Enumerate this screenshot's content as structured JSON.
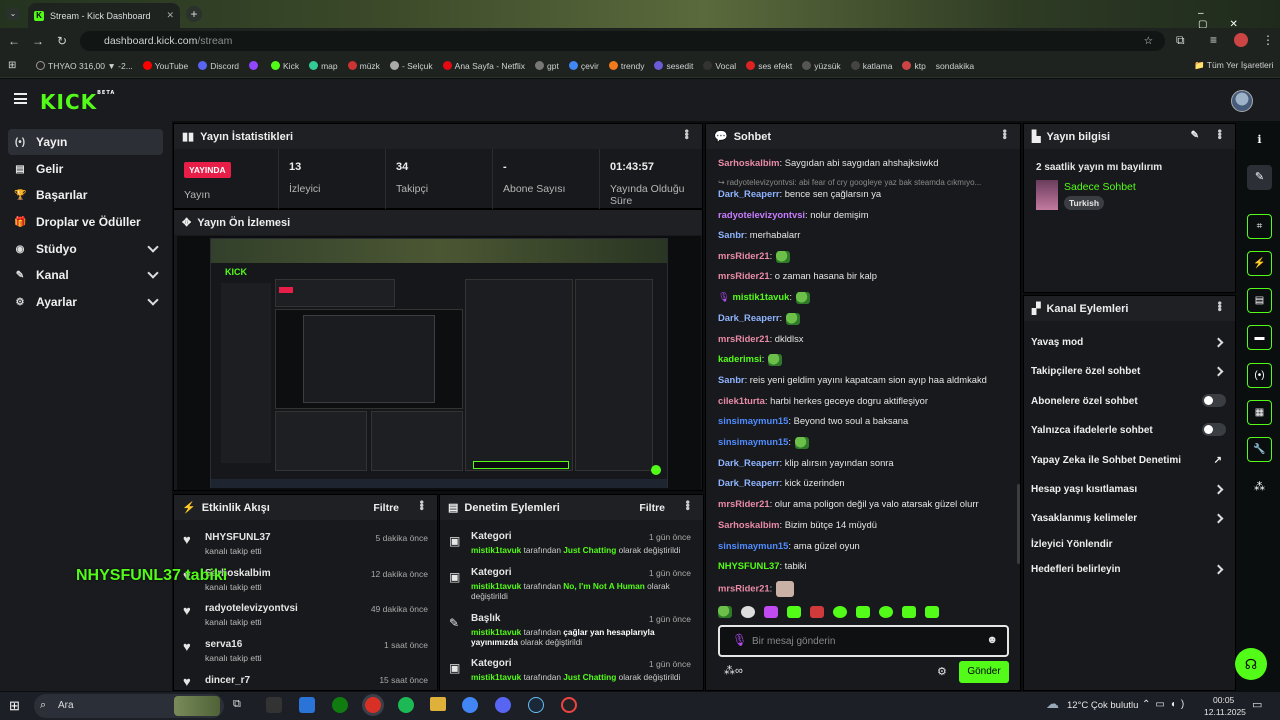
{
  "browser": {
    "tab_title": "Stream - Kick Dashboard",
    "url_host": "dashboard.kick.com",
    "url_path": "/stream",
    "bookmarks": [
      "THYAO 316,00 ▼ -2...",
      "YouTube",
      "Discord",
      "",
      "Kick",
      "map",
      "müzk",
      "- Selçuk",
      "Ana Sayfa - Netflix",
      "gpt",
      "çevir",
      "trendy",
      "sesedit",
      "Vocal",
      "ses efekt",
      "yüzsük",
      "katlama",
      "ktp",
      "sondakika"
    ],
    "all_bookmarks": "Tüm Yer İşaretleri"
  },
  "sidebar": {
    "items": [
      {
        "label": "Yayın",
        "icon": "(•)"
      },
      {
        "label": "Gelir",
        "icon": "▤"
      },
      {
        "label": "Başarılar",
        "icon": "🏆"
      },
      {
        "label": "Droplar ve Ödüller",
        "icon": "🎁"
      },
      {
        "label": "Stüdyo",
        "icon": "◉"
      },
      {
        "label": "Kanal",
        "icon": "✎"
      },
      {
        "label": "Ayarlar",
        "icon": "⚙"
      }
    ]
  },
  "stats": {
    "title": "Yayın İstatistikleri",
    "live_badge": "YAYINDA",
    "live_label": "Yayın",
    "viewers_val": "13",
    "viewers_lbl": "İzleyici",
    "followers_val": "34",
    "followers_lbl": "Takipçi",
    "subs_val": "-",
    "subs_lbl": "Abone Sayısı",
    "uptime_val": "01:43:57",
    "uptime_lbl": "Yayında Olduğu Süre"
  },
  "preview": {
    "title": "Yayın Ön İzlemesi"
  },
  "activity": {
    "title": "Etkinlik Akışı",
    "filter": "Filtre",
    "items": [
      {
        "name": "NHYSFUNL37",
        "desc": "kanalı takip etti",
        "time": "5 dakika önce"
      },
      {
        "name": "Sarhoskalbim",
        "desc": "kanalı takip etti",
        "time": "12 dakika önce"
      },
      {
        "name": "radyotelevizyontvsi",
        "desc": "kanalı takip etti",
        "time": "49 dakika önce"
      },
      {
        "name": "serva16",
        "desc": "kanalı takip etti",
        "time": "1 saat önce"
      },
      {
        "name": "dincer_r7",
        "desc": "",
        "time": "15 saat önce"
      }
    ],
    "overlay": "NHYSFUNL37 tabiki"
  },
  "moderation": {
    "title": "Denetim Eylemleri",
    "filter": "Filtre",
    "items": [
      {
        "kind": "Kategori",
        "time": "1 gün önce",
        "user": "mistik1tavuk",
        "mid": " tarafından ",
        "value": "Just Chatting",
        "tail": " olarak değiştirildi"
      },
      {
        "kind": "Kategori",
        "time": "1 gün önce",
        "user": "mistik1tavuk",
        "mid": " tarafından ",
        "value": "No, I'm Not A Human",
        "tail": " olarak değiştirildi"
      },
      {
        "kind": "Başlık",
        "time": "1 gün önce",
        "user": "mistik1tavuk",
        "mid": " tarafından ",
        "value": "çağlar yan hesaplarıyla yayınımızda",
        "tail": " olarak değiştirildi"
      },
      {
        "kind": "Kategori",
        "time": "1 gün önce",
        "user": "mistik1tavuk",
        "mid": " tarafından ",
        "value": "Just Chatting",
        "tail": " olarak değiştirildi"
      }
    ]
  },
  "chat": {
    "title": "Sohbet",
    "messages": [
      {
        "user": "Sarhoskalbim",
        "color": "#e98ba7",
        "text": ": Saygıdan abi saygıdan ahshajksiwkd"
      },
      {
        "user": "",
        "color": "#8a8a8a",
        "text": "↪ radyotelevizyontvsi: abi fear of cry googleye yaz bak steamda cıkmıyo..."
      },
      {
        "user": "Dark_Reaperr",
        "color": "#8fb4ff",
        "text": ": bence sen çağlarsın ya"
      },
      {
        "user": "radyotelevizyontvsi",
        "color": "#c77dff",
        "text": ": nolur demişim"
      },
      {
        "user": "Sanbr",
        "color": "#8fb4ff",
        "text": ": merhabalarr"
      },
      {
        "user": "mrsRider21",
        "color": "#e98ba7",
        "text": ":"
      },
      {
        "user": "mrsRider21",
        "color": "#e98ba7",
        "text": ": o zaman hasana bir kalp"
      },
      {
        "user": "mistik1tavuk",
        "color": "#53fc18",
        "text": ":"
      },
      {
        "user": "Dark_Reaperr",
        "color": "#8fb4ff",
        "text": ":"
      },
      {
        "user": "mrsRider21",
        "color": "#e98ba7",
        "text": ": dkldlsx"
      },
      {
        "user": "kaderimsi",
        "color": "#53fc18",
        "text": ":"
      },
      {
        "user": "Sanbr",
        "color": "#8fb4ff",
        "text": ": reis yeni geldim yayını kapatcam sion ayıp haa aldmkakd"
      },
      {
        "user": "cilek1turta",
        "color": "#e98ba7",
        "text": ": harbi herkes geceye dogru aktifleşiyor"
      },
      {
        "user": "sinsimaymun15",
        "color": "#4f8cff",
        "text": ": Beyond two soul a baksana"
      },
      {
        "user": "sinsimaymun15",
        "color": "#4f8cff",
        "text": ":"
      },
      {
        "user": "Dark_Reaperr",
        "color": "#8fb4ff",
        "text": ": klip alırsın yayından sonra"
      },
      {
        "user": "Dark_Reaperr",
        "color": "#8fb4ff",
        "text": ": kick üzerinden"
      },
      {
        "user": "mrsRider21",
        "color": "#e98ba7",
        "text": ": olur ama poligon değil ya valo atarsak güzel olurr"
      },
      {
        "user": "Sarhoskalbim",
        "color": "#e98ba7",
        "text": ": Bizim bütçe 14 müydü"
      },
      {
        "user": "sinsimaymun15",
        "color": "#4f8cff",
        "text": ": ama güzel oyun"
      },
      {
        "user": "NHYSFUNL37",
        "color": "#53fc18",
        "text": ": tabiki"
      },
      {
        "user": "mrsRider21",
        "color": "#e98ba7",
        "text": ":"
      }
    ],
    "input_placeholder": "Bir mesaj gönderin",
    "send": "Gönder"
  },
  "stream_info": {
    "title": "Yayın bilgisi",
    "stream_title": "2 saatlik yayın mı bayılırım",
    "category": "Sadece Sohbet",
    "tag": "Turkish"
  },
  "channel_actions": {
    "title": "Kanal Eylemleri",
    "items": [
      {
        "label": "Yavaş mod",
        "ctrl": "chev"
      },
      {
        "label": "Takipçilere özel sohbet",
        "ctrl": "chev"
      },
      {
        "label": "Abonelere özel sohbet",
        "ctrl": "toggle"
      },
      {
        "label": "Yalnızca ifadelerle sohbet",
        "ctrl": "toggle"
      },
      {
        "label": "Yapay Zeka ile Sohbet Denetimi",
        "ctrl": "ext"
      },
      {
        "label": "Hesap yaşı kısıtlaması",
        "ctrl": "chev"
      },
      {
        "label": "Yasaklanmış kelimeler",
        "ctrl": "chev"
      },
      {
        "label": "İzleyici Yönlendir",
        "ctrl": "none"
      },
      {
        "label": "Hedefleri belirleyin",
        "ctrl": "chev"
      }
    ]
  },
  "taskbar": {
    "search": "Ara",
    "weather": "12°C  Çok bulutlu",
    "time": "00:05",
    "date": "12.11.2025"
  },
  "colors": {
    "accent": "#53fc18",
    "live": "#e91e48",
    "panel": "#18191c"
  }
}
